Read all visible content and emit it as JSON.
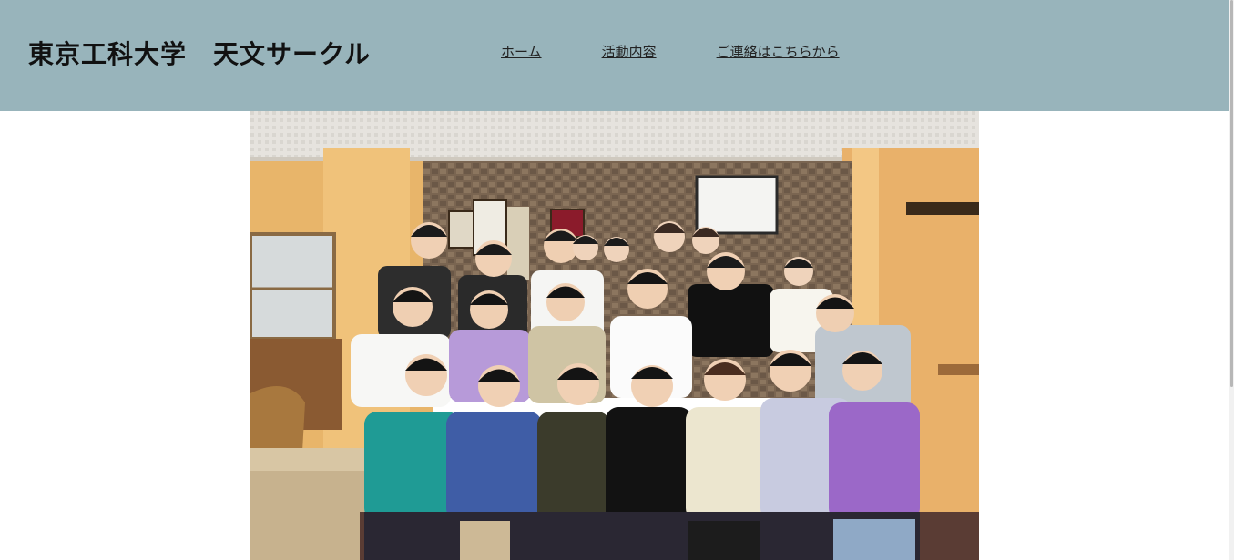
{
  "header": {
    "site_title": "東京工科大学　天文サークル",
    "background_color": "#98b4bb"
  },
  "nav": {
    "items": [
      {
        "label": "ホーム"
      },
      {
        "label": "活動内容"
      },
      {
        "label": "ご連絡はこちらから"
      }
    ]
  },
  "main": {
    "photo_subject": "group-photo"
  }
}
